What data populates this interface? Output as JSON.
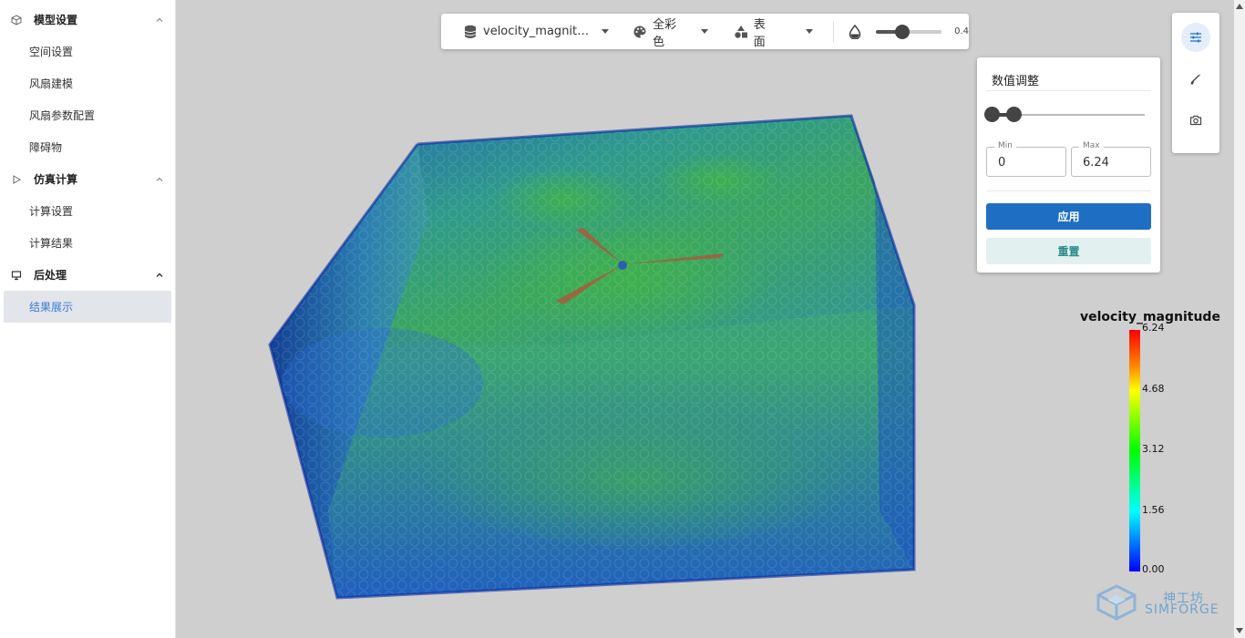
{
  "sidebar": {
    "groups": [
      {
        "label": "模型设置",
        "items": [
          "空间设置",
          "风扇建模",
          "风扇参数配置",
          "障碍物"
        ]
      },
      {
        "label": "仿真计算",
        "items": [
          "计算设置",
          "计算结果"
        ]
      },
      {
        "label": "后处理",
        "items": [
          "结果展示"
        ]
      }
    ]
  },
  "toolbar": {
    "field_select": "velocity_magnit…",
    "color_select": "全彩色",
    "render_select": "表面",
    "opacity_value": "0.4",
    "opacity": 0.4
  },
  "panel": {
    "title": "数值调整",
    "min_label": "Min",
    "min_value": "0",
    "max_label": "Max",
    "max_value": "6.24",
    "apply_label": "应用",
    "reset_label": "重置"
  },
  "legend": {
    "title": "velocity_magnitude",
    "ticks": [
      "6.24",
      "4.68",
      "3.12",
      "1.56",
      "0.00"
    ]
  },
  "brand": {
    "name_cn": "神工坊",
    "name_en": "SIMFORGE"
  },
  "colors": {
    "accent": "#1e6fc4",
    "active_text": "#3a7bd5",
    "reset_bg": "#e3f0f0"
  }
}
